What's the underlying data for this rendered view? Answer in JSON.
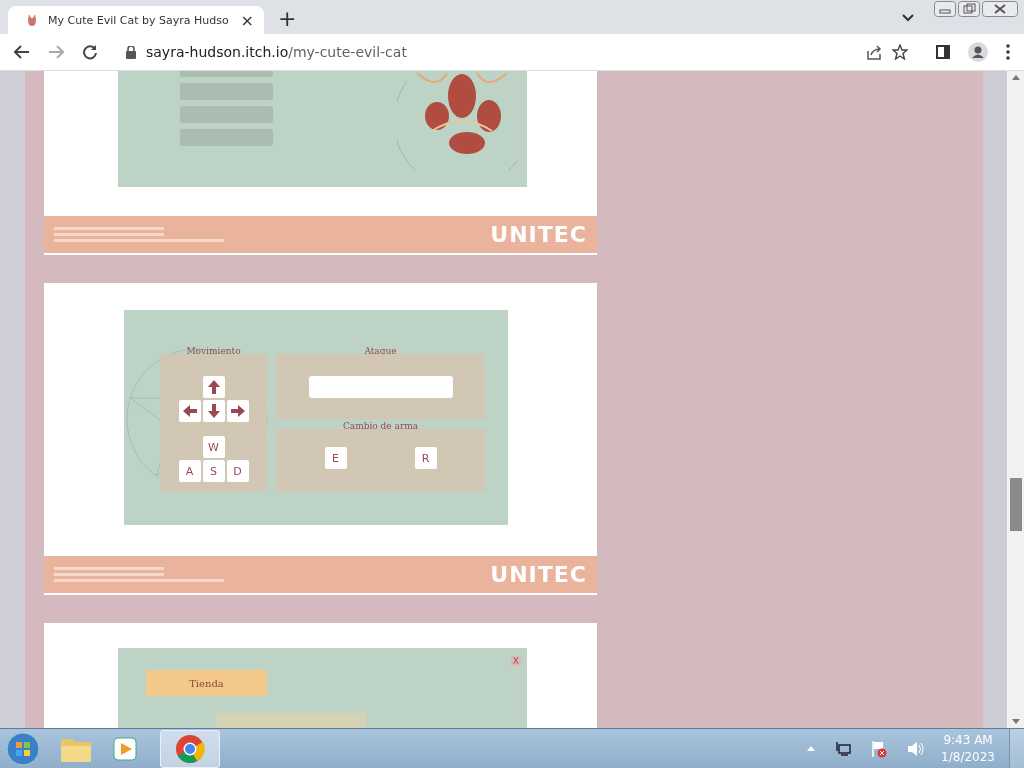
{
  "browser": {
    "tab_title": "My Cute Evil Cat by Sayra Hudso",
    "tab_close": "×",
    "new_tab": "+",
    "url_host": "sayra-hudson.itch.io",
    "url_path": "/my-cute-evil-cat"
  },
  "slides": [
    {
      "kind": "menu",
      "logo": "UNITEC"
    },
    {
      "kind": "controls",
      "logo": "UNITEC",
      "movement_title": "Movimiento",
      "wasd": [
        "W",
        "A",
        "S",
        "D"
      ],
      "attack_title": "Ataque",
      "weapon_title": "Cambio de arma",
      "weapon_keys": [
        "E",
        "R"
      ]
    },
    {
      "kind": "shop",
      "shop_label": "Tienda",
      "close": "X"
    }
  ],
  "taskbar": {
    "time": "9:43 AM",
    "date": "1/8/2023"
  }
}
